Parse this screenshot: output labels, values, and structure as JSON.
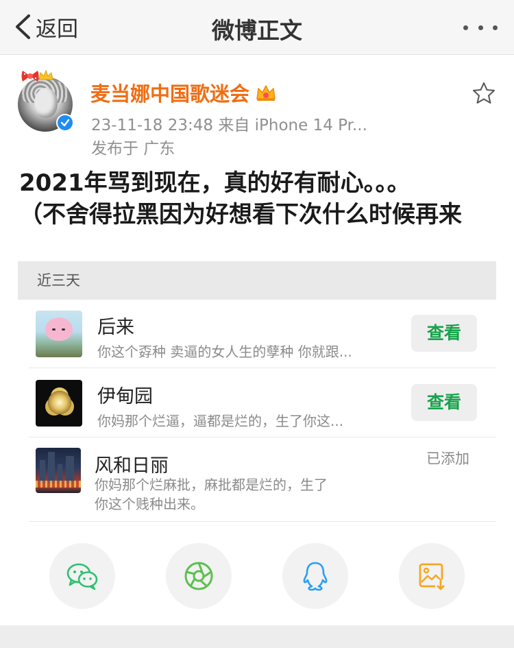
{
  "nav": {
    "back_label": "返回",
    "title": "微博正文",
    "more_icon": "more-dots-icon"
  },
  "post": {
    "username": "麦当娜中国歌迷会",
    "timestamp": "23-11-18 23:48",
    "source": "来自 iPhone 14 Pr...",
    "location": "发布于 广东",
    "text_lines": [
      "2021年骂到现在，真的好有耐心。。。",
      "（不舍得拉黑因为好想看下次什么时候再来"
    ],
    "verified_color": "#1e8cf0",
    "username_color": "#f06d13"
  },
  "card": {
    "header": "近三天",
    "items": [
      {
        "title": "后来",
        "subtitle": "你这个孬种 卖逼的女人生的孽种 你就跟...",
        "action": "查看"
      },
      {
        "title": "伊甸园",
        "subtitle": "你妈那个烂逼，逼都是烂的，生了你这...",
        "action": "查看"
      },
      {
        "title": "风和日丽",
        "subtitle_lines": [
          "你妈那个烂麻批，麻批都是烂的，生了",
          "你这个贱种出来。"
        ],
        "status": "已添加"
      }
    ],
    "action_color": "#17a34a"
  },
  "share": {
    "icons": [
      "wechat-icon",
      "moments-icon",
      "qq-icon",
      "save-image-icon"
    ]
  }
}
